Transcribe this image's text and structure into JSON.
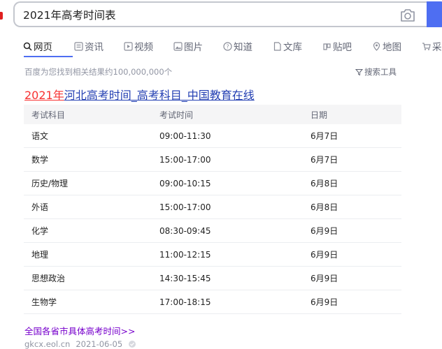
{
  "search": {
    "query": "2021年高考时间表"
  },
  "tabs": [
    {
      "label": "网页",
      "icon": "search-icon"
    },
    {
      "label": "资讯",
      "icon": "news-icon"
    },
    {
      "label": "视频",
      "icon": "video-icon"
    },
    {
      "label": "图片",
      "icon": "image-icon"
    },
    {
      "label": "知道",
      "icon": "question-icon"
    },
    {
      "label": "文库",
      "icon": "document-icon"
    },
    {
      "label": "贴吧",
      "icon": "tieba-icon"
    },
    {
      "label": "地图",
      "icon": "map-icon"
    },
    {
      "label": "采",
      "icon": "cart-icon"
    }
  ],
  "stats": "百度为您找到相关结果约100,000,000个",
  "tools_label": "搜索工具",
  "result": {
    "title_highlight": "2021年",
    "title_rest": "河北高考时间_高考科目_中国教育在线",
    "headers": [
      "考试科目",
      "考试时间",
      "日期"
    ],
    "rows": [
      [
        "语文",
        "09:00-11:30",
        "6月7日"
      ],
      [
        "数学",
        "15:00-17:00",
        "6月7日"
      ],
      [
        "历史/物理",
        "09:00-10:15",
        "6月8日"
      ],
      [
        "外语",
        "15:00-17:00",
        "6月8日"
      ],
      [
        "化学",
        "08:30-09:45",
        "6月9日"
      ],
      [
        "地理",
        "11:00-12:15",
        "6月9日"
      ],
      [
        "思想政治",
        "14:30-15:45",
        "6月9日"
      ],
      [
        "生物学",
        "17:00-18:15",
        "6月9日"
      ]
    ],
    "more_link": "全国各省市具体高考时间>>",
    "source_url": "gkcx.eol.cn",
    "source_date": "2021-06-05"
  },
  "colors": {
    "accent": "#4e6ef2",
    "link": "#2440b3",
    "highlight": "#f73131",
    "visited": "#7700cc"
  }
}
